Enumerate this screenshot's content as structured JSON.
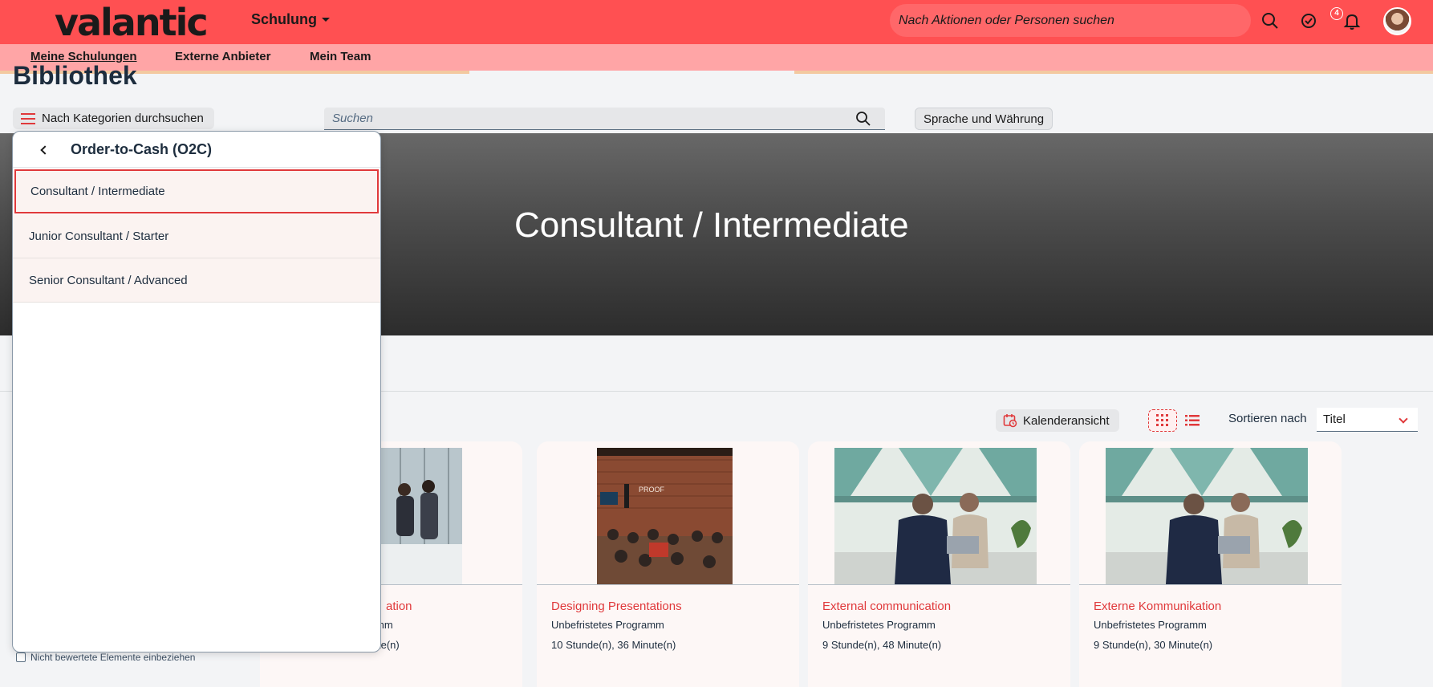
{
  "shell": {
    "logo": "valantic",
    "product_menu": "Schulung",
    "search_placeholder": "Nach Aktionen oder Personen suchen",
    "notification_count": "4"
  },
  "subnav": {
    "items": [
      "Meine Schulungen",
      "Externe Anbieter",
      "Mein Team"
    ]
  },
  "page": {
    "title": "Bibliothek"
  },
  "toolbar": {
    "category_button": "Nach Kategorien durchsuchen",
    "search_placeholder": "Suchen",
    "language_button": "Sprache und Währung"
  },
  "hero": {
    "title": "Consultant / Intermediate"
  },
  "results_toolbar": {
    "calendar_button": "Kalenderansicht",
    "sort_label": "Sortieren nach",
    "sort_value": "Titel"
  },
  "filters": {
    "include_unrated": "Nicht bewertete Elemente einbeziehen"
  },
  "popover": {
    "title": "Order-to-Cash (O2C)",
    "items": [
      "Consultant / Intermediate",
      "Junior Consultant / Starter",
      "Senior Consultant / Advanced"
    ]
  },
  "cards": [
    {
      "title": "ation",
      "type": "mm",
      "duration": "te(n)"
    },
    {
      "title": "Designing Presentations",
      "type": "Unbefristetes Programm",
      "duration": "10 Stunde(n), 36 Minute(n)"
    },
    {
      "title": "External communication",
      "type": "Unbefristetes Programm",
      "duration": "9 Stunde(n), 48 Minute(n)"
    },
    {
      "title": "Externe Kommunikation",
      "type": "Unbefristetes Programm",
      "duration": "9 Stunde(n), 30 Minute(n)"
    }
  ],
  "colors": {
    "brand_red": "#ff5052",
    "subnav_pink": "#ffa5a6",
    "accent_red": "#e0393b"
  }
}
